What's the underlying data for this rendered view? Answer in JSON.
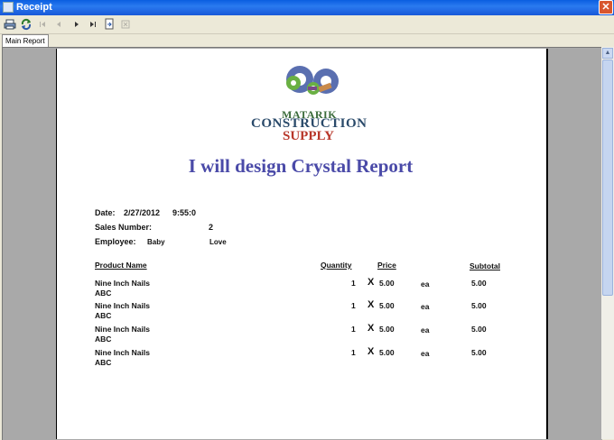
{
  "window": {
    "title": "Receipt",
    "close": "✕"
  },
  "toolbar": {
    "print_icon": "print-icon",
    "refresh_icon": "refresh-icon",
    "first_icon": "first-page-icon",
    "prev_icon": "previous-page-icon",
    "next_icon": "next-page-icon",
    "last_icon": "last-page-icon",
    "goto_icon": "goto-page-icon",
    "close_icon": "close-view-icon"
  },
  "tabs": [
    {
      "label": "Main Report"
    }
  ],
  "logo": {
    "line1": "Matarik",
    "line2": "Construction",
    "line3": "Supply"
  },
  "report": {
    "title": "I will design Crystal Report",
    "date_label": "Date:",
    "date_value": "2/27/2012",
    "time_value": "9:55:0",
    "sales_label": "Sales Number:",
    "sales_value": "2",
    "employee_label": "Employee:",
    "employee_first": "Baby",
    "employee_last": "Love",
    "headers": {
      "product": "Product Name",
      "quantity": "Quantity",
      "price": "Price",
      "subtotal": "Subtotal"
    },
    "rows": [
      {
        "name": "Nine Inch Nails",
        "sub": "ABC",
        "qty": "1",
        "x": "X",
        "price": "5.00",
        "unit": "ea",
        "subtotal": "5.00"
      },
      {
        "name": "Nine Inch Nails",
        "sub": "ABC",
        "qty": "1",
        "x": "X",
        "price": "5.00",
        "unit": "ea",
        "subtotal": "5.00"
      },
      {
        "name": "Nine Inch Nails",
        "sub": "ABC",
        "qty": "1",
        "x": "X",
        "price": "5.00",
        "unit": "ea",
        "subtotal": "5.00"
      },
      {
        "name": "Nine Inch Nails",
        "sub": "ABC",
        "qty": "1",
        "x": "X",
        "price": "5.00",
        "unit": "ea",
        "subtotal": "5.00"
      }
    ]
  },
  "colors": {
    "title_blue": "#4a4aa8",
    "titlebar": "#0a5ee0",
    "viewer_gray": "#a9a9a9"
  }
}
